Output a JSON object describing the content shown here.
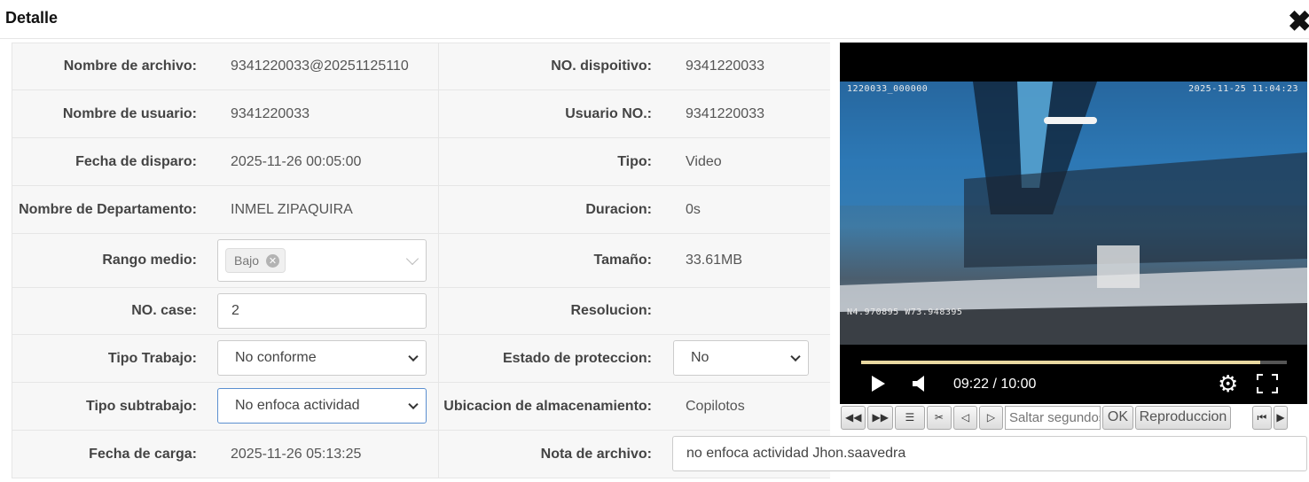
{
  "dialog": {
    "title": "Detalle",
    "close_icon": "close-icon"
  },
  "fields": {
    "nombre_archivo": {
      "label": "Nombre de archivo:",
      "value": "9341220033@20251125110"
    },
    "no_dispositivo": {
      "label": "NO. dispoitivo:",
      "value": "9341220033"
    },
    "nombre_usuario": {
      "label": "Nombre de usuario:",
      "value": "9341220033"
    },
    "usuario_no": {
      "label": "Usuario NO.:",
      "value": "9341220033"
    },
    "fecha_disparo": {
      "label": "Fecha de disparo:",
      "value": "2025-11-26 00:05:00"
    },
    "tipo": {
      "label": "Tipo:",
      "value": "Video"
    },
    "nombre_departamento": {
      "label": "Nombre de Departamento:",
      "value": "INMEL ZIPAQUIRA"
    },
    "duracion": {
      "label": "Duracion:",
      "value": "0s"
    },
    "rango_medio": {
      "label": "Rango medio:",
      "tag": "Bajo"
    },
    "tamano": {
      "label": "Tamaño:",
      "value": "33.61MB"
    },
    "no_case": {
      "label": "NO. case:",
      "value": "2"
    },
    "resolucion": {
      "label": "Resolucion:",
      "value": ""
    },
    "tipo_trabajo": {
      "label": "Tipo Trabajo:",
      "value": "No conforme"
    },
    "estado_proteccion": {
      "label": "Estado de proteccion:",
      "value": "No"
    },
    "tipo_subtrabajo": {
      "label": "Tipo subtrabajo:",
      "value": "No enfoca actividad"
    },
    "ubicacion": {
      "label": "Ubicacion de almacenamiento:",
      "value": "Copilotos"
    },
    "fecha_carga": {
      "label": "Fecha de carga:",
      "value": "2025-11-26 05:13:25"
    },
    "nota_archivo": {
      "label": "Nota de archivo:",
      "value": "no enfoca actividad Jhon.saavedra"
    }
  },
  "player": {
    "osd_top_left": "1220033_000000",
    "osd_top_right": "2025-11-25 11:04:23",
    "osd_gps": "N4.970895 W73.948395",
    "time": "09:22 / 10:00",
    "progress": 0.937,
    "icons": [
      "play-icon",
      "volume-icon",
      "settings-icon",
      "fullscreen-icon"
    ]
  },
  "toolbar": {
    "seek_placeholder": "Saltar segundos",
    "ok_label": "OK",
    "playback_label": "Reproduccion"
  }
}
